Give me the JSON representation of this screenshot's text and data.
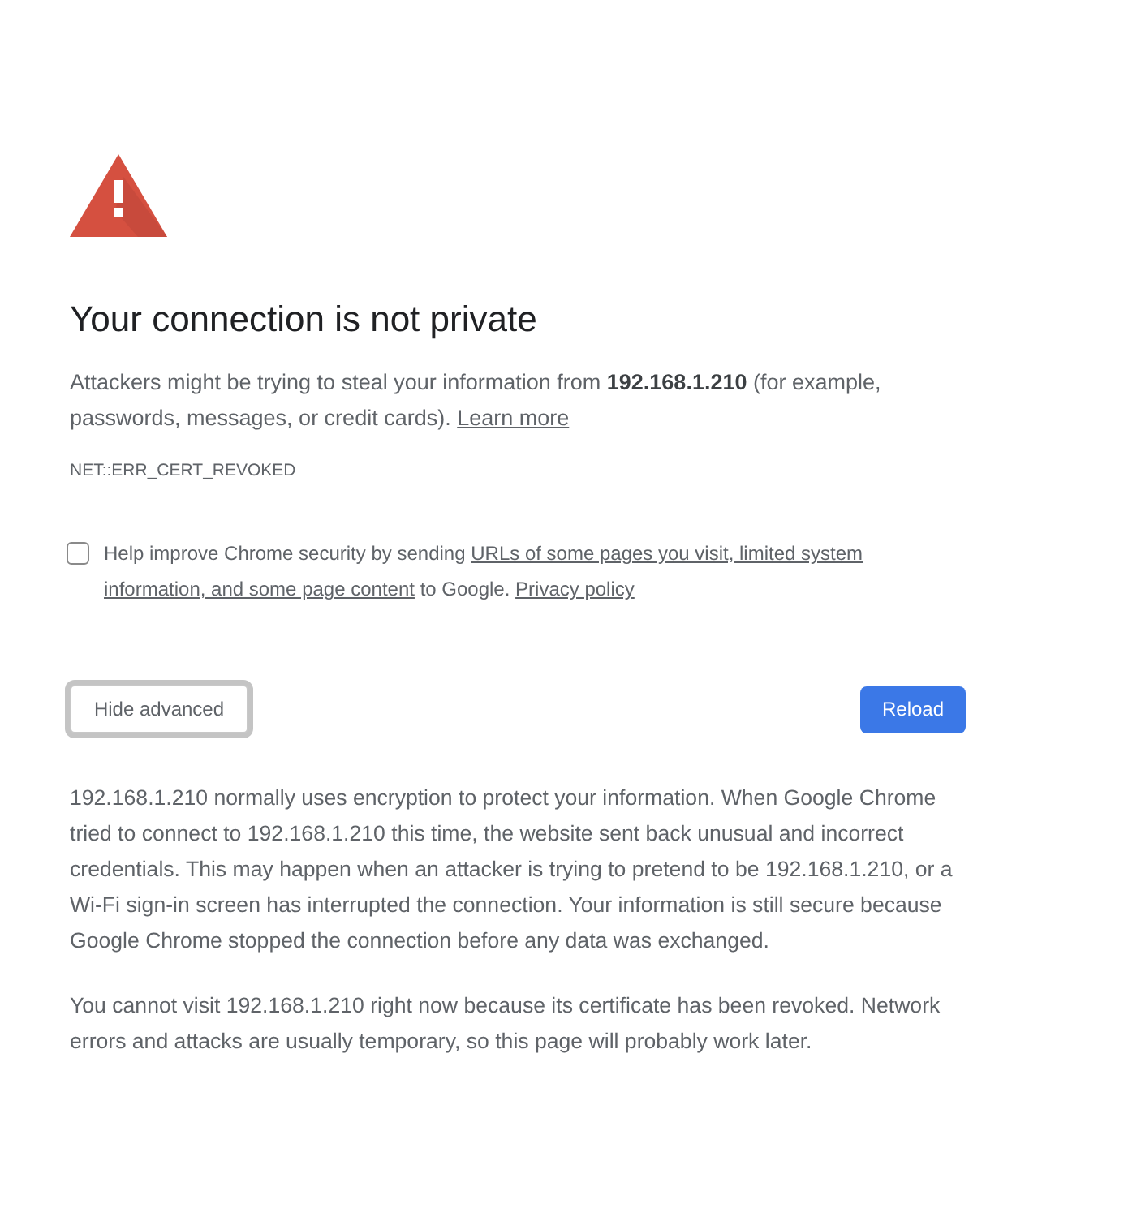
{
  "heading": "Your connection is not private",
  "intro": {
    "text": "Attackers might be trying to steal your information from **192.168.1.210** (for example, passwords, messages, or credit cards).",
    "link": "Learn more"
  },
  "error_code": "NET::ERR_CERT_REVOKED",
  "opt_in": {
    "checked": false,
    "segments": [
      {
        "kind": "text",
        "text": "Help improve Chrome security by sending"
      },
      {
        "kind": "link",
        "text": "URLs of some pages you visit, limited system"
      },
      {
        "kind": "link",
        "text": "information, and some page content"
      },
      {
        "kind": "text",
        "text": "to Google."
      },
      {
        "kind": "link",
        "text": "Privacy policy"
      }
    ]
  },
  "buttons": [
    {
      "label": "Hide advanced",
      "kind": "secondary"
    },
    {
      "label": "Reload",
      "kind": "primary"
    }
  ],
  "details": [
    "192.168.1.210 normally uses encryption to protect your information. When Google Chrome tried to connect to 192.168.1.210 this time, the website sent back unusual and incorrect credentials. This may happen when an attacker is trying to pretend to be 192.168.1.210, or a Wi-Fi sign-in screen has interrupted the connection. Your information is still secure because Google Chrome stopped the connection before any data was exchanged.",
    "You cannot visit 192.168.1.210 right now because its certificate has been revoked. Network errors and attacks are usually temporary, so this page will probably work later."
  ]
}
